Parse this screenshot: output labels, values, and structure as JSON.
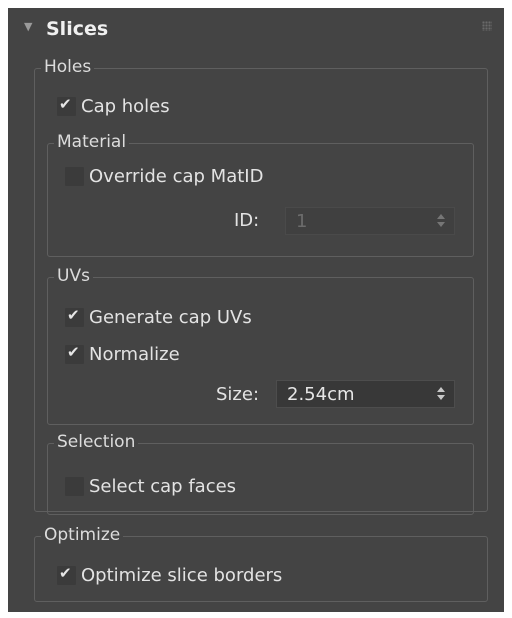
{
  "rollout": {
    "title": "Slices",
    "expanded": true
  },
  "holes": {
    "title": "Holes",
    "cap_holes": {
      "label": "Cap holes",
      "checked": true
    },
    "material": {
      "title": "Material",
      "override_cap_matid": {
        "label": "Override cap MatID",
        "checked": false
      },
      "id_label": "ID:",
      "id_value": "1",
      "id_enabled": false
    },
    "uvs": {
      "title": "UVs",
      "generate_cap_uvs": {
        "label": "Generate cap UVs",
        "checked": true
      },
      "normalize": {
        "label": "Normalize",
        "checked": true
      },
      "size_label": "Size:",
      "size_value": "2.54cm"
    },
    "selection": {
      "title": "Selection",
      "select_cap_faces": {
        "label": "Select cap faces",
        "checked": false
      }
    }
  },
  "optimize": {
    "title": "Optimize",
    "optimize_slice_borders": {
      "label": "Optimize slice borders",
      "checked": true
    }
  },
  "colors": {
    "panel_bg": "#444444",
    "group_border": "#5f5f5f",
    "text": "#dcdcdc"
  }
}
